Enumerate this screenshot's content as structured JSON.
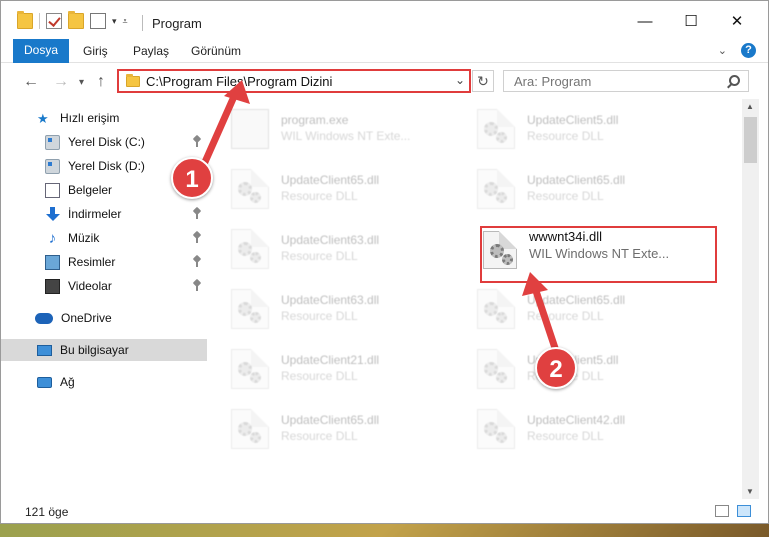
{
  "window": {
    "title": "Program"
  },
  "ribbon": {
    "tabs": [
      {
        "label": "Dosya"
      },
      {
        "label": "Giriş"
      },
      {
        "label": "Paylaş"
      },
      {
        "label": "Görünüm"
      }
    ]
  },
  "address": {
    "path": "C:\\Program Files\\Program Dizini"
  },
  "search": {
    "placeholder": "Ara: Program"
  },
  "sidebar": {
    "items": [
      {
        "label": "Hızlı erişim",
        "icon": "star-icon"
      },
      {
        "label": "Yerel Disk (C:)",
        "icon": "disk-icon"
      },
      {
        "label": "Yerel Disk (D:)",
        "icon": "disk-icon"
      },
      {
        "label": "Belgeler",
        "icon": "documents-icon"
      },
      {
        "label": "İndirmeler",
        "icon": "downloads-icon"
      },
      {
        "label": "Müzik",
        "icon": "music-icon"
      },
      {
        "label": "Resimler",
        "icon": "pictures-icon"
      },
      {
        "label": "Videolar",
        "icon": "videos-icon"
      },
      {
        "label": "OneDrive",
        "icon": "cloud-icon"
      },
      {
        "label": "Bu bilgisayar",
        "icon": "computer-icon"
      },
      {
        "label": "Ağ",
        "icon": "network-icon"
      }
    ]
  },
  "files": [
    {
      "name": "program.exe",
      "desc": "WIL Windows NT Exte..."
    },
    {
      "name": "UpdateClient5.dll",
      "desc": "Resource DLL"
    },
    {
      "name": "UpdateClient65.dll",
      "desc": "Resource DLL"
    },
    {
      "name": "UpdateClient65.dll",
      "desc": "Resource DLL"
    },
    {
      "name": "UpdateClient63.dll",
      "desc": "Resource DLL"
    },
    {
      "name": "wwwnt34i.dll",
      "desc": "WIL Windows NT Exte..."
    },
    {
      "name": "UpdateClient63.dll",
      "desc": "Resource DLL"
    },
    {
      "name": "UpdateClient65.dll",
      "desc": "Resource DLL"
    },
    {
      "name": "UpdateClient21.dll",
      "desc": "Resource DLL"
    },
    {
      "name": "UpdateClient5.dll",
      "desc": "Resource DLL"
    },
    {
      "name": "UpdateClient65.dll",
      "desc": "Resource DLL"
    },
    {
      "name": "UpdateClient42.dll",
      "desc": "Resource DLL"
    }
  ],
  "status": {
    "count": "121 öge"
  },
  "annotations": {
    "step1": "1",
    "step2": "2",
    "color": "#e04040"
  },
  "colors": {
    "accent": "#1979ca",
    "highlight": "#e03c3c"
  }
}
